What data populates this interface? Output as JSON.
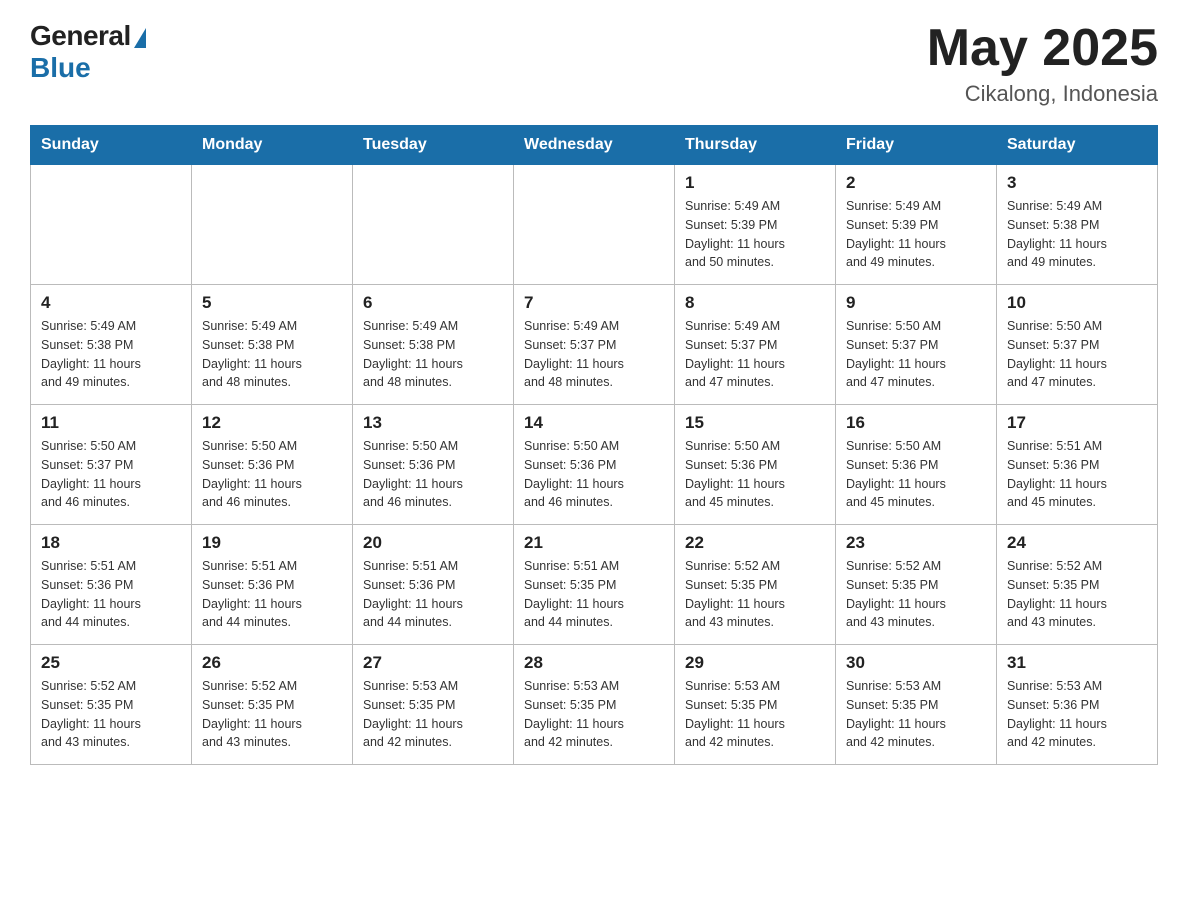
{
  "header": {
    "logo_general": "General",
    "logo_blue": "Blue",
    "month_title": "May 2025",
    "location": "Cikalong, Indonesia"
  },
  "weekdays": [
    "Sunday",
    "Monday",
    "Tuesday",
    "Wednesday",
    "Thursday",
    "Friday",
    "Saturday"
  ],
  "weeks": [
    [
      {
        "day": "",
        "info": ""
      },
      {
        "day": "",
        "info": ""
      },
      {
        "day": "",
        "info": ""
      },
      {
        "day": "",
        "info": ""
      },
      {
        "day": "1",
        "info": "Sunrise: 5:49 AM\nSunset: 5:39 PM\nDaylight: 11 hours\nand 50 minutes."
      },
      {
        "day": "2",
        "info": "Sunrise: 5:49 AM\nSunset: 5:39 PM\nDaylight: 11 hours\nand 49 minutes."
      },
      {
        "day": "3",
        "info": "Sunrise: 5:49 AM\nSunset: 5:38 PM\nDaylight: 11 hours\nand 49 minutes."
      }
    ],
    [
      {
        "day": "4",
        "info": "Sunrise: 5:49 AM\nSunset: 5:38 PM\nDaylight: 11 hours\nand 49 minutes."
      },
      {
        "day": "5",
        "info": "Sunrise: 5:49 AM\nSunset: 5:38 PM\nDaylight: 11 hours\nand 48 minutes."
      },
      {
        "day": "6",
        "info": "Sunrise: 5:49 AM\nSunset: 5:38 PM\nDaylight: 11 hours\nand 48 minutes."
      },
      {
        "day": "7",
        "info": "Sunrise: 5:49 AM\nSunset: 5:37 PM\nDaylight: 11 hours\nand 48 minutes."
      },
      {
        "day": "8",
        "info": "Sunrise: 5:49 AM\nSunset: 5:37 PM\nDaylight: 11 hours\nand 47 minutes."
      },
      {
        "day": "9",
        "info": "Sunrise: 5:50 AM\nSunset: 5:37 PM\nDaylight: 11 hours\nand 47 minutes."
      },
      {
        "day": "10",
        "info": "Sunrise: 5:50 AM\nSunset: 5:37 PM\nDaylight: 11 hours\nand 47 minutes."
      }
    ],
    [
      {
        "day": "11",
        "info": "Sunrise: 5:50 AM\nSunset: 5:37 PM\nDaylight: 11 hours\nand 46 minutes."
      },
      {
        "day": "12",
        "info": "Sunrise: 5:50 AM\nSunset: 5:36 PM\nDaylight: 11 hours\nand 46 minutes."
      },
      {
        "day": "13",
        "info": "Sunrise: 5:50 AM\nSunset: 5:36 PM\nDaylight: 11 hours\nand 46 minutes."
      },
      {
        "day": "14",
        "info": "Sunrise: 5:50 AM\nSunset: 5:36 PM\nDaylight: 11 hours\nand 46 minutes."
      },
      {
        "day": "15",
        "info": "Sunrise: 5:50 AM\nSunset: 5:36 PM\nDaylight: 11 hours\nand 45 minutes."
      },
      {
        "day": "16",
        "info": "Sunrise: 5:50 AM\nSunset: 5:36 PM\nDaylight: 11 hours\nand 45 minutes."
      },
      {
        "day": "17",
        "info": "Sunrise: 5:51 AM\nSunset: 5:36 PM\nDaylight: 11 hours\nand 45 minutes."
      }
    ],
    [
      {
        "day": "18",
        "info": "Sunrise: 5:51 AM\nSunset: 5:36 PM\nDaylight: 11 hours\nand 44 minutes."
      },
      {
        "day": "19",
        "info": "Sunrise: 5:51 AM\nSunset: 5:36 PM\nDaylight: 11 hours\nand 44 minutes."
      },
      {
        "day": "20",
        "info": "Sunrise: 5:51 AM\nSunset: 5:36 PM\nDaylight: 11 hours\nand 44 minutes."
      },
      {
        "day": "21",
        "info": "Sunrise: 5:51 AM\nSunset: 5:35 PM\nDaylight: 11 hours\nand 44 minutes."
      },
      {
        "day": "22",
        "info": "Sunrise: 5:52 AM\nSunset: 5:35 PM\nDaylight: 11 hours\nand 43 minutes."
      },
      {
        "day": "23",
        "info": "Sunrise: 5:52 AM\nSunset: 5:35 PM\nDaylight: 11 hours\nand 43 minutes."
      },
      {
        "day": "24",
        "info": "Sunrise: 5:52 AM\nSunset: 5:35 PM\nDaylight: 11 hours\nand 43 minutes."
      }
    ],
    [
      {
        "day": "25",
        "info": "Sunrise: 5:52 AM\nSunset: 5:35 PM\nDaylight: 11 hours\nand 43 minutes."
      },
      {
        "day": "26",
        "info": "Sunrise: 5:52 AM\nSunset: 5:35 PM\nDaylight: 11 hours\nand 43 minutes."
      },
      {
        "day": "27",
        "info": "Sunrise: 5:53 AM\nSunset: 5:35 PM\nDaylight: 11 hours\nand 42 minutes."
      },
      {
        "day": "28",
        "info": "Sunrise: 5:53 AM\nSunset: 5:35 PM\nDaylight: 11 hours\nand 42 minutes."
      },
      {
        "day": "29",
        "info": "Sunrise: 5:53 AM\nSunset: 5:35 PM\nDaylight: 11 hours\nand 42 minutes."
      },
      {
        "day": "30",
        "info": "Sunrise: 5:53 AM\nSunset: 5:35 PM\nDaylight: 11 hours\nand 42 minutes."
      },
      {
        "day": "31",
        "info": "Sunrise: 5:53 AM\nSunset: 5:36 PM\nDaylight: 11 hours\nand 42 minutes."
      }
    ]
  ]
}
